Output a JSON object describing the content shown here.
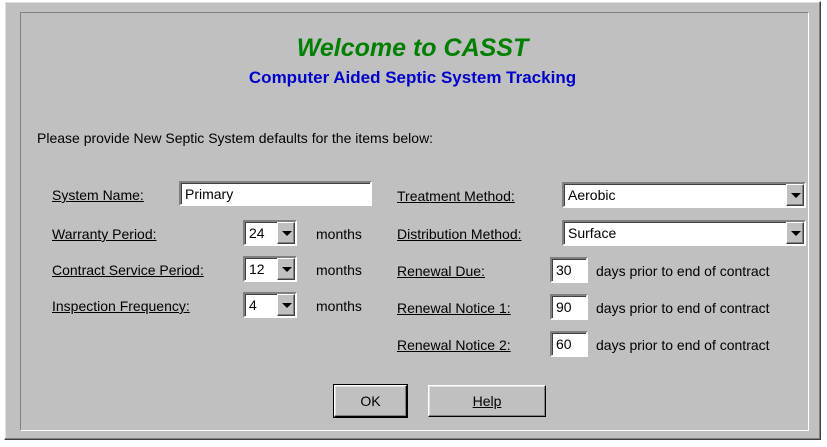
{
  "header": {
    "title": "Welcome to CASST",
    "subtitle": "Computer Aided Septic System Tracking"
  },
  "instructions": "Please provide New Septic System defaults for the items below:",
  "left": {
    "system_name": {
      "label": "System Name:",
      "value": "Primary"
    },
    "warranty": {
      "label": "Warranty Period:",
      "value": "24",
      "unit": "months"
    },
    "contract": {
      "label": "Contract Service Period:",
      "value": "12",
      "unit": "months"
    },
    "inspection": {
      "label": "Inspection Frequency:",
      "value": "4",
      "unit": "months"
    }
  },
  "right": {
    "treatment": {
      "label": "Treatment Method:",
      "value": "Aerobic"
    },
    "distribution": {
      "label": "Distribution Method:",
      "value": "Surface"
    },
    "renewal_due": {
      "label": "Renewal Due:",
      "value": "30",
      "suffix": "days prior to end of contract"
    },
    "notice1": {
      "label": "Renewal Notice 1:",
      "value": "90",
      "suffix": "days prior to end of contract"
    },
    "notice2": {
      "label": "Renewal Notice 2:",
      "value": "60",
      "suffix": "days prior to end of contract"
    }
  },
  "buttons": {
    "ok": "OK",
    "help": "Help"
  },
  "icons": {
    "dropdown": "chevron-down-icon"
  }
}
